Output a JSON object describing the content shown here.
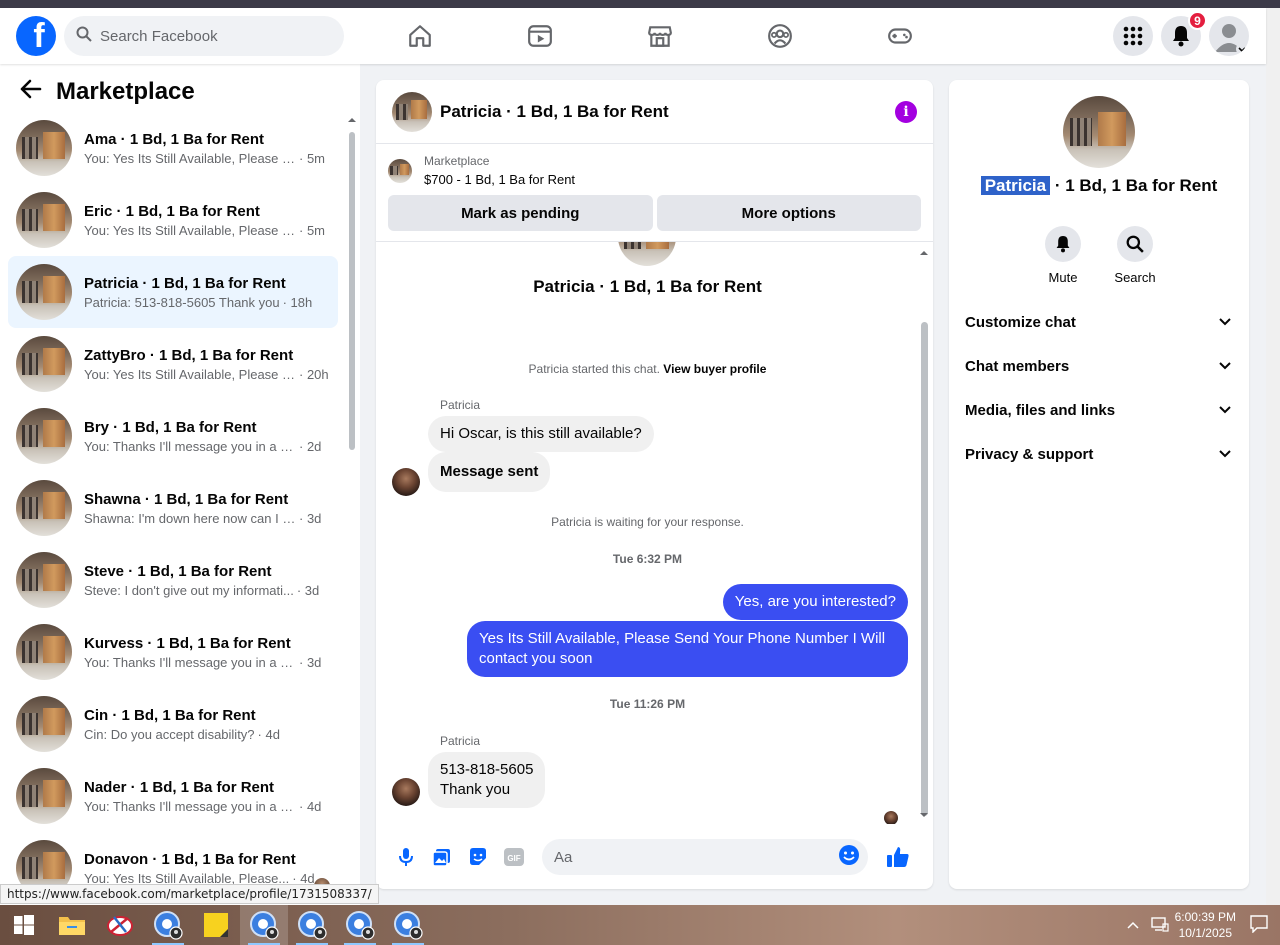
{
  "topbar": {
    "search_placeholder": "Search Facebook",
    "notification_count": "9",
    "nav_icons": [
      "home-icon",
      "video-icon",
      "marketplace-icon",
      "groups-icon",
      "gaming-icon"
    ]
  },
  "sidebar": {
    "title": "Marketplace",
    "conversations": [
      {
        "name": "Ama · 1 Bd, 1 Ba for Rent",
        "preview": "You: Yes Its Still Available, Please S...",
        "time": "· 5m",
        "active": false
      },
      {
        "name": "Eric · 1 Bd, 1 Ba for Rent",
        "preview": "You: Yes Its Still Available, Please S...",
        "time": "· 5m",
        "active": false
      },
      {
        "name": "Patricia · 1 Bd, 1 Ba for Rent",
        "preview": "Patricia: 513-818-5605 Thank you",
        "time": "· 18h",
        "active": true
      },
      {
        "name": "ZattyBro · 1 Bd, 1 Ba for Rent",
        "preview": "You: Yes Its Still Available, Please S...",
        "time": "· 20h",
        "active": false
      },
      {
        "name": "Bry · 1 Bd, 1 Ba for Rent",
        "preview": "You: Thanks I'll message you in a m...",
        "time": "· 2d",
        "active": false
      },
      {
        "name": "Shawna · 1 Bd, 1 Ba for Rent",
        "preview": "Shawna: I'm down here now can I s...",
        "time": "· 3d",
        "active": false
      },
      {
        "name": "Steve · 1 Bd, 1 Ba for Rent",
        "preview": "Steve: I don't give out my informati...",
        "time": "· 3d",
        "active": false
      },
      {
        "name": "Kurvess · 1 Bd, 1 Ba for Rent",
        "preview": "You: Thanks I'll message you in a m...",
        "time": "· 3d",
        "active": false
      },
      {
        "name": "Cin · 1 Bd, 1 Ba for Rent",
        "preview": "Cin: Do you accept disability?",
        "time": "· 4d",
        "active": false
      },
      {
        "name": "Nader · 1 Bd, 1 Ba for Rent",
        "preview": "You: Thanks I'll message you in a m...",
        "time": "· 4d",
        "active": false
      },
      {
        "name": "Donavon · 1 Bd, 1 Ba for Rent",
        "preview": "You: Yes Its Still Available, Please...",
        "time": "· 4d",
        "active": false
      }
    ]
  },
  "chat": {
    "header_title": "Patricia · 1 Bd, 1 Ba for Rent",
    "marketplace_label": "Marketplace",
    "listing": "$700 - 1 Bd, 1 Ba for Rent",
    "mark_pending": "Mark as pending",
    "more_options": "More options",
    "top_name": "Patricia · 1 Bd, 1 Ba for Rent",
    "started_text": "Patricia started this chat.",
    "view_profile": "View buyer profile",
    "sender1": "Patricia",
    "msg1": "Hi Oscar, is this still available?",
    "msg2": "Message sent",
    "waiting": "Patricia is waiting for your response.",
    "time1": "Tue 6:32 PM",
    "out1": "Yes, are you interested?",
    "out2": "Yes Its Still Available, Please Send Your Phone Number I Will contact you soon",
    "time2": "Tue 11:26 PM",
    "sender2": "Patricia",
    "msg3_line1": "513-818-5605",
    "msg3_line2": "Thank you",
    "composer_placeholder": "Aa"
  },
  "right_panel": {
    "name_highlight": "Patricia",
    "name_rest": " · 1 Bd, 1 Ba for Rent",
    "mute": "Mute",
    "search": "Search",
    "menu": [
      "Customize chat",
      "Chat members",
      "Media, files and links",
      "Privacy & support"
    ]
  },
  "status_url": "https://www.facebook.com/marketplace/profile/1731508337/",
  "taskbar": {
    "time": "6:00:39 PM",
    "date": "10/1/2025"
  },
  "colors": {
    "brand": "#0866ff",
    "outgoing": "#3a4ef2",
    "info": "#a300e0",
    "badge": "#e41e3f"
  }
}
